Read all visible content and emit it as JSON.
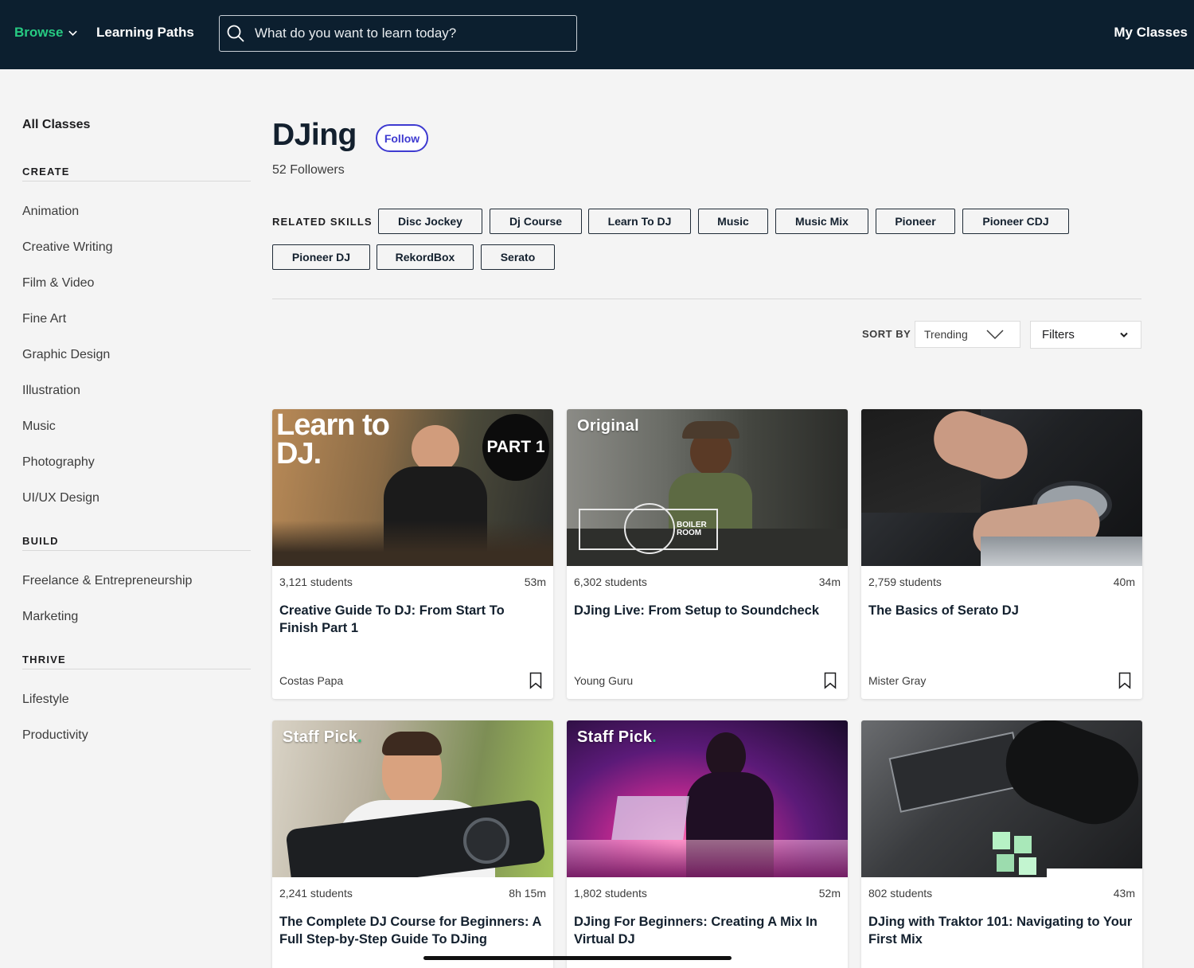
{
  "nav": {
    "browse": "Browse",
    "learning_paths": "Learning Paths",
    "search_placeholder": "What do you want to learn today?",
    "my_classes": "My Classes"
  },
  "sidebar": {
    "all_classes": "All Classes",
    "sections": [
      {
        "heading": "CREATE",
        "items": [
          "Animation",
          "Creative Writing",
          "Film & Video",
          "Fine Art",
          "Graphic Design",
          "Illustration",
          "Music",
          "Photography",
          "UI/UX Design"
        ]
      },
      {
        "heading": "BUILD",
        "items": [
          "Freelance & Entrepreneurship",
          "Marketing"
        ]
      },
      {
        "heading": "THRIVE",
        "items": [
          "Lifestyle",
          "Productivity"
        ]
      }
    ]
  },
  "page": {
    "title": "DJing",
    "follow": "Follow",
    "followers": "52 Followers",
    "related_skills_label": "RELATED SKILLS",
    "skills": [
      "Disc Jockey",
      "Dj Course",
      "Learn To DJ",
      "Music",
      "Music Mix",
      "Pioneer",
      "Pioneer CDJ",
      "Pioneer DJ",
      "RekordBox",
      "Serato"
    ]
  },
  "sort": {
    "label": "SORT BY",
    "selected": "Trending",
    "filters": "Filters"
  },
  "cards": [
    {
      "badge": "",
      "thumb_text_1": "Learn to",
      "thumb_text_2": "DJ.",
      "thumb_badge": "PART 1",
      "students": "3,121 students",
      "duration": "53m",
      "title": "Creative Guide To DJ: From Start To Finish Part 1",
      "teacher": "Costas Papa"
    },
    {
      "badge": "Original",
      "thumb_text_1": "BOILER ROOM",
      "students": "6,302 students",
      "duration": "34m",
      "title": "DJing Live: From Setup to Soundcheck",
      "teacher": "Young Guru"
    },
    {
      "badge": "",
      "students": "2,759 students",
      "duration": "40m",
      "title": "The Basics of Serato DJ",
      "teacher": "Mister Gray"
    },
    {
      "badge": "Staff Pick",
      "students": "2,241 students",
      "duration": "8h 15m",
      "title": "The Complete DJ Course for Beginners: A Full Step-by-Step Guide To DJing",
      "teacher": ""
    },
    {
      "badge": "Staff Pick",
      "students": "1,802 students",
      "duration": "52m",
      "title": "DJing For Beginners: Creating A Mix In Virtual DJ",
      "teacher": ""
    },
    {
      "badge": "",
      "students": "802 students",
      "duration": "43m",
      "title": "DJing with Traktor 101: Navigating to Your First Mix",
      "teacher": ""
    }
  ],
  "colors": {
    "header_bg": "#0c1f2f",
    "accent_green": "#27ca82",
    "follow_purple": "#3e3ad0",
    "page_bg": "#f4f4f4"
  }
}
